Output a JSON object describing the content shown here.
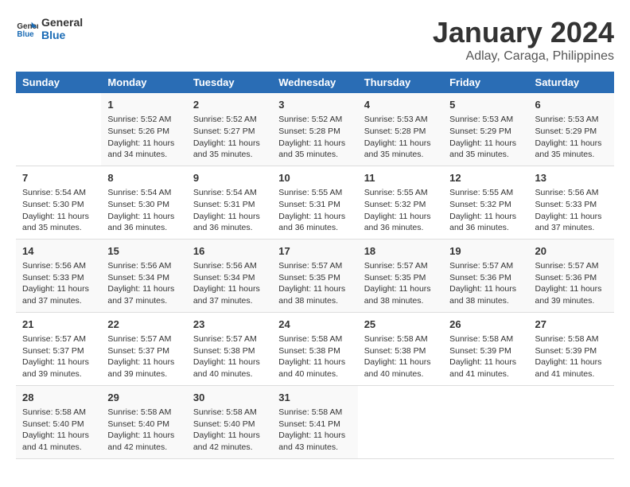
{
  "logo": {
    "text_general": "General",
    "text_blue": "Blue"
  },
  "title": "January 2024",
  "subtitle": "Adlay, Caraga, Philippines",
  "days_of_week": [
    "Sunday",
    "Monday",
    "Tuesday",
    "Wednesday",
    "Thursday",
    "Friday",
    "Saturday"
  ],
  "weeks": [
    [
      {
        "day": "",
        "info": ""
      },
      {
        "day": "1",
        "info": "Sunrise: 5:52 AM\nSunset: 5:26 PM\nDaylight: 11 hours\nand 34 minutes."
      },
      {
        "day": "2",
        "info": "Sunrise: 5:52 AM\nSunset: 5:27 PM\nDaylight: 11 hours\nand 35 minutes."
      },
      {
        "day": "3",
        "info": "Sunrise: 5:52 AM\nSunset: 5:28 PM\nDaylight: 11 hours\nand 35 minutes."
      },
      {
        "day": "4",
        "info": "Sunrise: 5:53 AM\nSunset: 5:28 PM\nDaylight: 11 hours\nand 35 minutes."
      },
      {
        "day": "5",
        "info": "Sunrise: 5:53 AM\nSunset: 5:29 PM\nDaylight: 11 hours\nand 35 minutes."
      },
      {
        "day": "6",
        "info": "Sunrise: 5:53 AM\nSunset: 5:29 PM\nDaylight: 11 hours\nand 35 minutes."
      }
    ],
    [
      {
        "day": "7",
        "info": "Sunrise: 5:54 AM\nSunset: 5:30 PM\nDaylight: 11 hours\nand 35 minutes."
      },
      {
        "day": "8",
        "info": "Sunrise: 5:54 AM\nSunset: 5:30 PM\nDaylight: 11 hours\nand 36 minutes."
      },
      {
        "day": "9",
        "info": "Sunrise: 5:54 AM\nSunset: 5:31 PM\nDaylight: 11 hours\nand 36 minutes."
      },
      {
        "day": "10",
        "info": "Sunrise: 5:55 AM\nSunset: 5:31 PM\nDaylight: 11 hours\nand 36 minutes."
      },
      {
        "day": "11",
        "info": "Sunrise: 5:55 AM\nSunset: 5:32 PM\nDaylight: 11 hours\nand 36 minutes."
      },
      {
        "day": "12",
        "info": "Sunrise: 5:55 AM\nSunset: 5:32 PM\nDaylight: 11 hours\nand 36 minutes."
      },
      {
        "day": "13",
        "info": "Sunrise: 5:56 AM\nSunset: 5:33 PM\nDaylight: 11 hours\nand 37 minutes."
      }
    ],
    [
      {
        "day": "14",
        "info": "Sunrise: 5:56 AM\nSunset: 5:33 PM\nDaylight: 11 hours\nand 37 minutes."
      },
      {
        "day": "15",
        "info": "Sunrise: 5:56 AM\nSunset: 5:34 PM\nDaylight: 11 hours\nand 37 minutes."
      },
      {
        "day": "16",
        "info": "Sunrise: 5:56 AM\nSunset: 5:34 PM\nDaylight: 11 hours\nand 37 minutes."
      },
      {
        "day": "17",
        "info": "Sunrise: 5:57 AM\nSunset: 5:35 PM\nDaylight: 11 hours\nand 38 minutes."
      },
      {
        "day": "18",
        "info": "Sunrise: 5:57 AM\nSunset: 5:35 PM\nDaylight: 11 hours\nand 38 minutes."
      },
      {
        "day": "19",
        "info": "Sunrise: 5:57 AM\nSunset: 5:36 PM\nDaylight: 11 hours\nand 38 minutes."
      },
      {
        "day": "20",
        "info": "Sunrise: 5:57 AM\nSunset: 5:36 PM\nDaylight: 11 hours\nand 39 minutes."
      }
    ],
    [
      {
        "day": "21",
        "info": "Sunrise: 5:57 AM\nSunset: 5:37 PM\nDaylight: 11 hours\nand 39 minutes."
      },
      {
        "day": "22",
        "info": "Sunrise: 5:57 AM\nSunset: 5:37 PM\nDaylight: 11 hours\nand 39 minutes."
      },
      {
        "day": "23",
        "info": "Sunrise: 5:57 AM\nSunset: 5:38 PM\nDaylight: 11 hours\nand 40 minutes."
      },
      {
        "day": "24",
        "info": "Sunrise: 5:58 AM\nSunset: 5:38 PM\nDaylight: 11 hours\nand 40 minutes."
      },
      {
        "day": "25",
        "info": "Sunrise: 5:58 AM\nSunset: 5:38 PM\nDaylight: 11 hours\nand 40 minutes."
      },
      {
        "day": "26",
        "info": "Sunrise: 5:58 AM\nSunset: 5:39 PM\nDaylight: 11 hours\nand 41 minutes."
      },
      {
        "day": "27",
        "info": "Sunrise: 5:58 AM\nSunset: 5:39 PM\nDaylight: 11 hours\nand 41 minutes."
      }
    ],
    [
      {
        "day": "28",
        "info": "Sunrise: 5:58 AM\nSunset: 5:40 PM\nDaylight: 11 hours\nand 41 minutes."
      },
      {
        "day": "29",
        "info": "Sunrise: 5:58 AM\nSunset: 5:40 PM\nDaylight: 11 hours\nand 42 minutes."
      },
      {
        "day": "30",
        "info": "Sunrise: 5:58 AM\nSunset: 5:40 PM\nDaylight: 11 hours\nand 42 minutes."
      },
      {
        "day": "31",
        "info": "Sunrise: 5:58 AM\nSunset: 5:41 PM\nDaylight: 11 hours\nand 43 minutes."
      },
      {
        "day": "",
        "info": ""
      },
      {
        "day": "",
        "info": ""
      },
      {
        "day": "",
        "info": ""
      }
    ]
  ]
}
